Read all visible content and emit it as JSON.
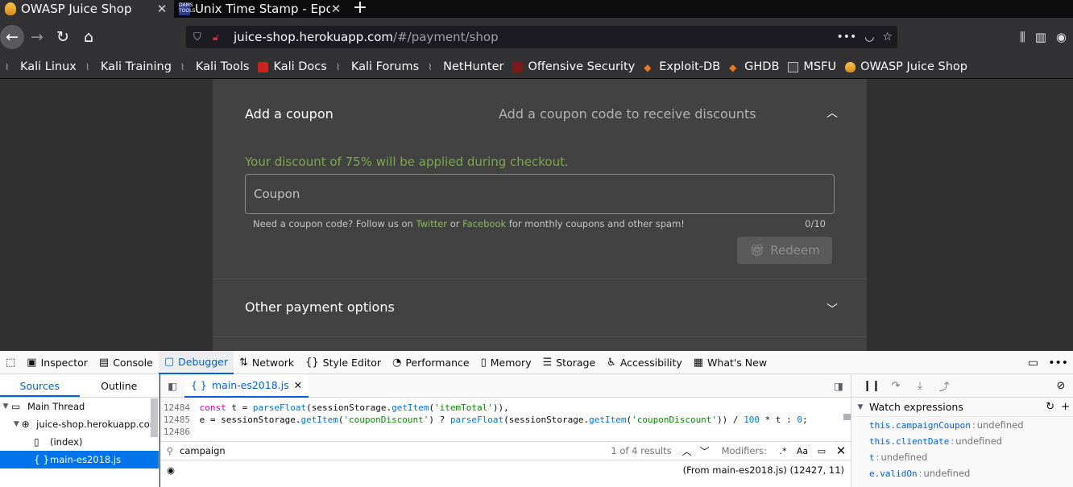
{
  "browser": {
    "tabs": [
      {
        "title": "OWASP Juice Shop",
        "active": true
      },
      {
        "title": "Unix Time Stamp - Epoch",
        "active": false
      }
    ],
    "url_host": "juice-shop.herokuapp.com",
    "url_path": "/#/payment/shop",
    "bookmarks": [
      "Kali Linux",
      "Kali Training",
      "Kali Tools",
      "Kali Docs",
      "Kali Forums",
      "NetHunter",
      "Offensive Security",
      "Exploit-DB",
      "GHDB",
      "MSFU",
      "OWASP Juice Shop"
    ]
  },
  "page": {
    "coupon_title": "Add a coupon",
    "coupon_description": "Add a coupon code to receive discounts",
    "discount_message": "Your discount of 75% will be applied during checkout.",
    "coupon_placeholder": "Coupon",
    "hint_prefix": "Need a coupon code? Follow us on",
    "hint_twitter": "Twitter",
    "hint_or": "or",
    "hint_facebook": "Facebook",
    "hint_suffix": "for monthly coupons and other spam!",
    "counter": "0/10",
    "redeem_label": "Redeem",
    "other_payment": "Other payment options"
  },
  "devtools": {
    "tabs": [
      "Inspector",
      "Console",
      "Debugger",
      "Network",
      "Style Editor",
      "Performance",
      "Memory",
      "Storage",
      "Accessibility",
      "What's New"
    ],
    "active_tab": "Debugger",
    "sources_tab": "Sources",
    "outline_tab": "Outline",
    "tree": {
      "thread": "Main Thread",
      "host": "juice-shop.herokuapp.com",
      "index": "(index)",
      "file": "main-es2018.js"
    },
    "editor_tab": "main-es2018.js",
    "code": {
      "line1_num": "12484",
      "line2_num": "12485",
      "line3_num": "12486"
    },
    "search": {
      "query": "campaign",
      "results": "1 of 4 results",
      "modifiers_label": "Modifiers:"
    },
    "status": {
      "location": "(From main-es2018.js)  (12427, 11)"
    },
    "watch": {
      "title": "Watch expressions",
      "items": [
        {
          "expr": "this.campaignCoupon",
          "value": "undefined"
        },
        {
          "expr": "this.clientDate",
          "value": "undefined"
        },
        {
          "expr": "t",
          "value": "undefined"
        },
        {
          "expr": "e.validOn",
          "value": "undefined"
        }
      ]
    }
  },
  "colors": {
    "accent": "#0060df",
    "discount_green": "#7ca94a",
    "panel_bg": "#424242"
  }
}
